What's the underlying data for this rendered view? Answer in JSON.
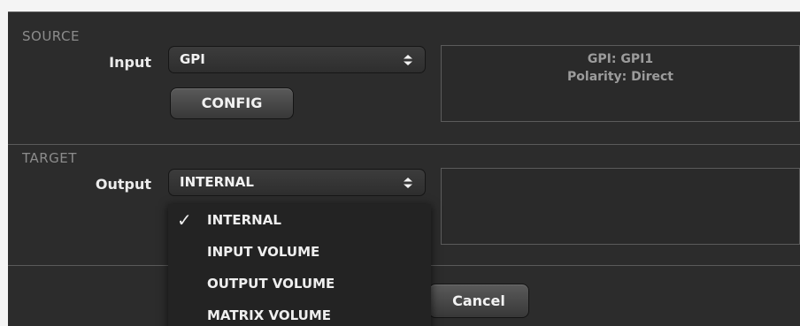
{
  "source": {
    "heading": "SOURCE",
    "input_label": "Input",
    "input_value": "GPI",
    "config_button": "CONFIG",
    "info_lines": [
      "GPI: GPI1",
      "Polarity: Direct"
    ]
  },
  "target": {
    "heading": "TARGET",
    "output_label": "Output",
    "output_value": "INTERNAL"
  },
  "footer": {
    "cancel_button": "Cancel"
  },
  "output_dropdown": {
    "check_mark": "✓",
    "options": [
      "INTERNAL",
      "INPUT VOLUME",
      "OUTPUT VOLUME",
      "MATRIX VOLUME"
    ],
    "selected_index": 0
  },
  "icons": {
    "select_arrows": "up-down-chevron-icon",
    "check": "checkmark-icon"
  }
}
